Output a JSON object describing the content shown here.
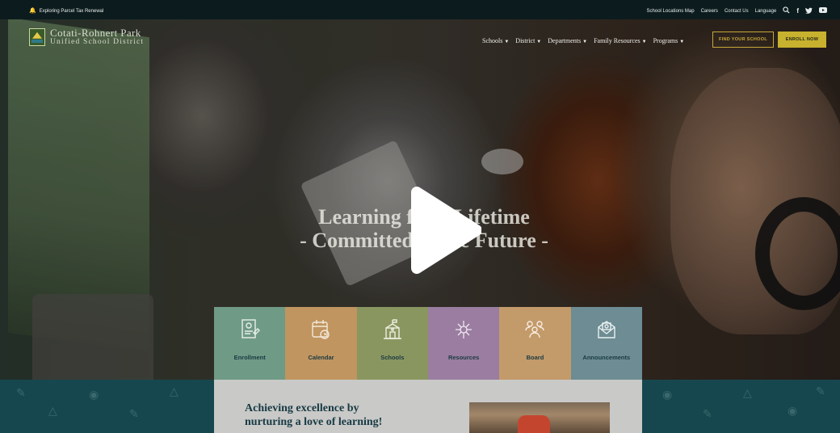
{
  "topbar": {
    "alert_text": "Exploring Parcel Tax Renewal",
    "links": [
      "School Locations Map",
      "Careers",
      "Contact Us",
      "Language"
    ]
  },
  "logo": {
    "line1": "Cotati-Rohnert Park",
    "line2": "Unified School District"
  },
  "nav": {
    "items": [
      "Schools",
      "District",
      "Departments",
      "Family Resources",
      "Programs"
    ],
    "find_school": "FIND YOUR SCHOOL",
    "enroll_now": "ENROLL NOW"
  },
  "hero": {
    "headline_line1": "Learning for a Lifetime",
    "headline_line2": "- Committed to the Future -"
  },
  "tiles": [
    {
      "label": "Enrollment",
      "icon": "enrollment-icon",
      "color": "#6f9a86"
    },
    {
      "label": "Calendar",
      "icon": "calendar-icon",
      "color": "#c09560"
    },
    {
      "label": "Schools",
      "icon": "school-icon",
      "color": "#8a9660"
    },
    {
      "label": "Resources",
      "icon": "resources-icon",
      "color": "#9a7da0"
    },
    {
      "label": "Board",
      "icon": "board-icon",
      "color": "#c39a6a"
    },
    {
      "label": "Announcements",
      "icon": "announcements-icon",
      "color": "#6d8c93"
    }
  ],
  "intro": {
    "tagline_line1": "Achieving excellence by",
    "tagline_line2": "nurturing a love of learning!"
  },
  "colors": {
    "accent_gold": "#c7b12e",
    "band_teal": "#17474e",
    "topbar": "#0c1c1e"
  }
}
